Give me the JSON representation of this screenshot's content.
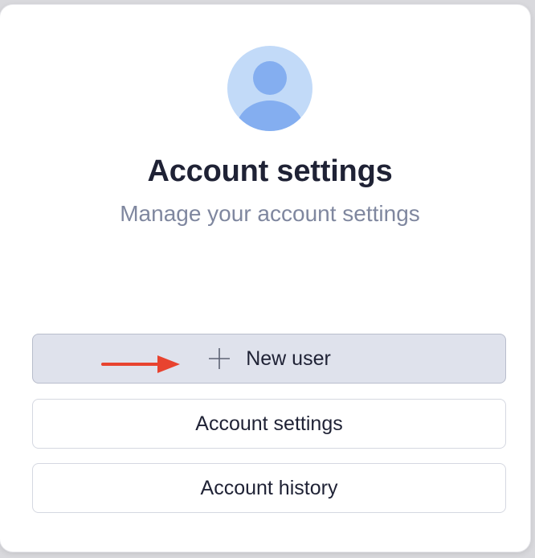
{
  "profile": {
    "title": "Account settings",
    "subtitle": "Manage your account settings"
  },
  "actions": {
    "new_user_label": "New user",
    "account_settings_label": "Account settings",
    "account_history_label": "Account history"
  },
  "icons": {
    "avatar": "user-avatar-icon",
    "plus": "plus-icon",
    "annotation": "red-arrow-icon"
  },
  "colors": {
    "avatar_bg": "#c2daf8",
    "avatar_fg": "#84aef0",
    "primary_btn_bg": "#dfe2ec",
    "arrow": "#e8432f"
  }
}
